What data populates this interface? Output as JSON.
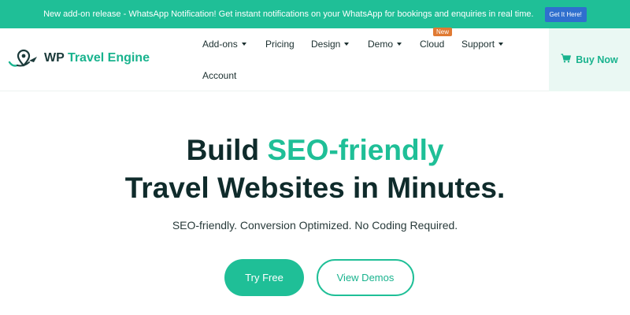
{
  "announcement": {
    "text": "New add-on release - WhatsApp Notification! Get instant notifications on your WhatsApp for bookings and enquiries in real time.",
    "cta": "Get It Here!"
  },
  "header": {
    "logo": {
      "wp": "WP",
      "rest": "Travel Engine",
      "icon": "map-pin-airplane-icon"
    },
    "nav": {
      "addons": "Add-ons",
      "pricing": "Pricing",
      "design": "Design",
      "demo": "Demo",
      "cloud": "Cloud",
      "cloud_badge": "New",
      "support": "Support",
      "account": "Account"
    },
    "buy_now": {
      "label": "Buy Now",
      "icon": "cart-icon"
    }
  },
  "hero": {
    "title_prefix": "Build ",
    "title_accent": "SEO-friendly",
    "title_line2": "Travel Websites in Minutes.",
    "subtitle": "SEO-friendly. Conversion Optimized. No Coding Required.",
    "primary_cta": "Try Free",
    "secondary_cta": "View Demos"
  },
  "colors": {
    "brand": "#1fbf97",
    "announce_button": "#2f6fce",
    "badge": "#e07a33",
    "heading": "#0f2b2b"
  }
}
